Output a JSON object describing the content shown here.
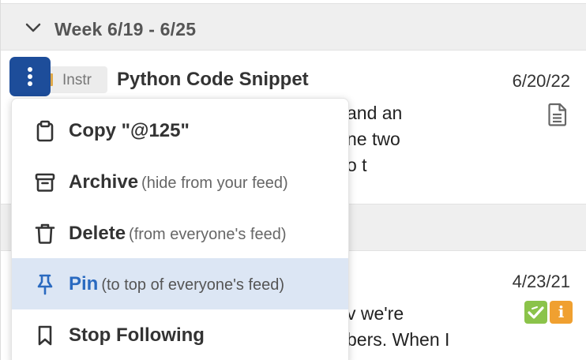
{
  "week": {
    "title": "Week 6/19 - 6/25"
  },
  "post1": {
    "badge": "Instr",
    "title": "Python Code Snippet",
    "date": "6/20/22",
    "snippet_lines": [
      "and an",
      "ne two",
      "o t"
    ]
  },
  "post2": {
    "date": "4/23/21",
    "snippet_lines": [
      "v we're",
      "bers. When I"
    ],
    "badge_orange_text": "i"
  },
  "menu": {
    "items": [
      {
        "label": "Copy \"@125\"",
        "hint": "",
        "icon": "clipboard-icon"
      },
      {
        "label": "Archive",
        "hint": "(hide from your feed)",
        "icon": "archive-icon"
      },
      {
        "label": "Delete",
        "hint": "(from everyone's feed)",
        "icon": "trash-icon"
      },
      {
        "label": "Pin",
        "hint": "(to top of everyone's feed)",
        "icon": "pin-icon"
      },
      {
        "label": "Stop Following",
        "hint": "",
        "icon": "bookmark-icon"
      }
    ]
  },
  "colors": {
    "accent": "#1d4d9a",
    "highlight": "#dce6f4",
    "pin_text": "#2a6ac0",
    "badge_green": "#8bc34a",
    "badge_orange": "#f0a030"
  }
}
